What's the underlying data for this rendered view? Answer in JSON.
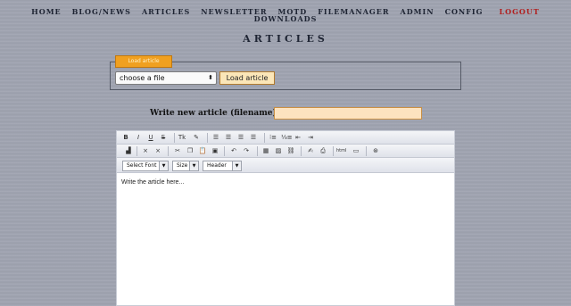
{
  "nav": {
    "row1": [
      "HOME",
      "BLOG/NEWS",
      "ARTICLES",
      "NEWSLETTER",
      "MOTD",
      "FILEMANAGER",
      "ADMIN",
      "CONFIG"
    ],
    "logout": "LOGOUT",
    "row2": [
      "DOWNLOADS"
    ]
  },
  "page_title": "ARTICLES",
  "file_panel": {
    "legend": "Load article",
    "select_value": "choose a file",
    "load_button": "Load article"
  },
  "new_article": {
    "label": "Write new article (filename):",
    "value": ""
  },
  "editor": {
    "toolbar1": [
      "B",
      "I",
      "U",
      "S",
      "Tk",
      "paint",
      "align-left",
      "align-center",
      "align-right",
      "justify",
      "ul",
      "ol",
      "outdent",
      "indent"
    ],
    "toolbar2": [
      "chart",
      "×",
      "×",
      "cut",
      "copy",
      "paste",
      "paste-word",
      "undo",
      "redo",
      "table",
      "image",
      "link",
      "spell",
      "print",
      "html",
      "box",
      "help"
    ],
    "font_select": "Select Font",
    "size_select": "Size",
    "header_select": "Header",
    "body_text": "Write the article here..."
  },
  "colors": {
    "background": "#9fa3b0",
    "legend": "#f0a020",
    "input_fill": "#fde3bf",
    "logout": "#b02020"
  }
}
